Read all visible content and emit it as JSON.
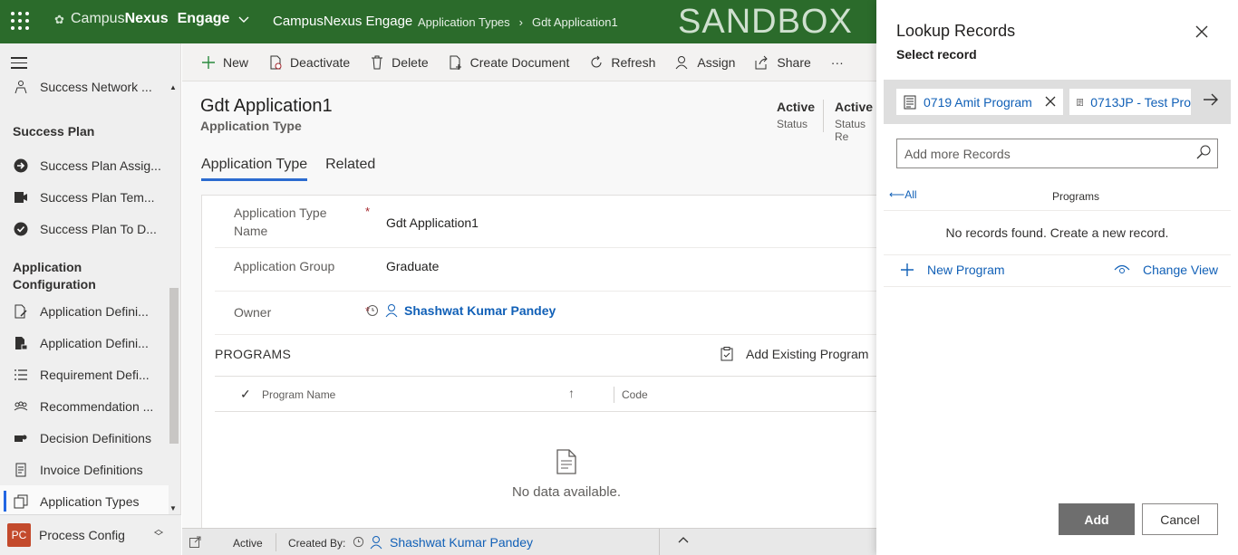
{
  "topbar": {
    "brand_prefix": "Campus",
    "brand_bold": "Nexus",
    "brand_suffix": "Engage",
    "app_name": "CampusNexus Engage",
    "breadcrumb": [
      "Application Types",
      "Gdt Application1"
    ],
    "environment": "SANDBOX",
    "bg_color": "#2b6b2b"
  },
  "sidebar": {
    "items_top": [
      {
        "label": "Success Network ...",
        "icon": "people-network-icon"
      }
    ],
    "group1": "Success Plan",
    "group1_items": [
      {
        "label": "Success Plan Assig...",
        "icon": "arrow-circle-icon"
      },
      {
        "label": "Success Plan Tem...",
        "icon": "template-icon"
      },
      {
        "label": "Success Plan To D...",
        "icon": "check-circle-icon"
      }
    ],
    "group2": "Application Configuration",
    "group2_items": [
      {
        "label": "Application Defini...",
        "icon": "document-pen-icon"
      },
      {
        "label": "Application Defini...",
        "icon": "document-lock-icon"
      },
      {
        "label": "Requirement Defi...",
        "icon": "list-icon"
      },
      {
        "label": "Recommendation ...",
        "icon": "people-icon"
      },
      {
        "label": "Decision Definitions",
        "icon": "gavel-icon"
      },
      {
        "label": "Invoice Definitions",
        "icon": "invoice-icon"
      },
      {
        "label": "Application Types",
        "icon": "copy-icon"
      }
    ],
    "area": {
      "badge": "PC",
      "label": "Process Config"
    }
  },
  "commands": [
    {
      "label": "New",
      "icon": "plus-icon"
    },
    {
      "label": "Deactivate",
      "icon": "deactivate-icon"
    },
    {
      "label": "Delete",
      "icon": "trash-icon"
    },
    {
      "label": "Create Document",
      "icon": "create-document-icon"
    },
    {
      "label": "Refresh",
      "icon": "refresh-icon"
    },
    {
      "label": "Assign",
      "icon": "assign-icon"
    },
    {
      "label": "Share",
      "icon": "share-icon"
    }
  ],
  "form": {
    "title": "Gdt Application1",
    "entity": "Application Type",
    "header_fields": [
      {
        "value": "Active",
        "label": "Status"
      },
      {
        "value": "Active",
        "label": "Status Re"
      }
    ],
    "tabs": [
      "Application Type",
      "Related"
    ],
    "fields": {
      "name_label": "Application Type Name",
      "name_label_line1": "Application Type",
      "name_label_line2": "Name",
      "name_value": "Gdt Application1",
      "group_label": "Application Group",
      "group_value": "Graduate",
      "owner_label": "Owner",
      "owner_value": "Shashwat Kumar Pandey",
      "required_mark": "*"
    },
    "programs": {
      "section_title": "PROGRAMS",
      "add_existing": "Add Existing Program",
      "columns": [
        "Program Name",
        "Code"
      ],
      "empty": "No data available."
    }
  },
  "footer": {
    "status": "Active",
    "created_by_label": "Created By:",
    "created_by": "Shashwat Kumar Pandey"
  },
  "lookup": {
    "title": "Lookup Records",
    "subtitle": "Select record",
    "selected": [
      {
        "label": "0719 Amit Program"
      },
      {
        "label": "0713JP - Test Pro"
      }
    ],
    "placeholder": "Add more Records",
    "all_link": "All",
    "entity_label": "Programs",
    "no_records": "No records found. Create a new record.",
    "new_record": "New Program",
    "change_view": "Change View",
    "add_button": "Add",
    "cancel_button": "Cancel"
  }
}
